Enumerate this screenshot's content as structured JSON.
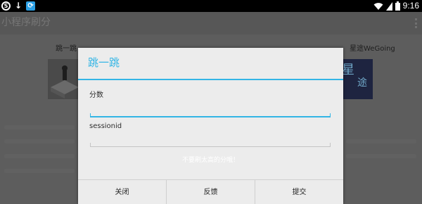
{
  "status_bar": {
    "time": "9:16",
    "left_icons": [
      "sogou-input-icon",
      "download-icon",
      "sync-icon"
    ],
    "right_icons": [
      "wifi-icon",
      "signal-icon",
      "battery-icon"
    ]
  },
  "app": {
    "title": "小程序刷分",
    "games": [
      {
        "label": "跳一跳",
        "icon": "jump-game-icon"
      },
      {
        "label": "",
        "icon": ""
      },
      {
        "label": "星途WeGoing",
        "icon": "wegoing-game-icon"
      }
    ]
  },
  "dialog": {
    "title": "跳一跳",
    "fields": [
      {
        "label": "分数",
        "value": "",
        "placeholder": ""
      },
      {
        "label": "sessionid",
        "value": "",
        "placeholder": ""
      }
    ],
    "hint": "不要刷太高的分哦！",
    "buttons": {
      "close": "关闭",
      "feedback": "反馈",
      "submit": "提交"
    }
  },
  "colors": {
    "accent": "#33b5e5",
    "dialog_bg": "#ececec",
    "scrim": "#5d5d5d"
  }
}
